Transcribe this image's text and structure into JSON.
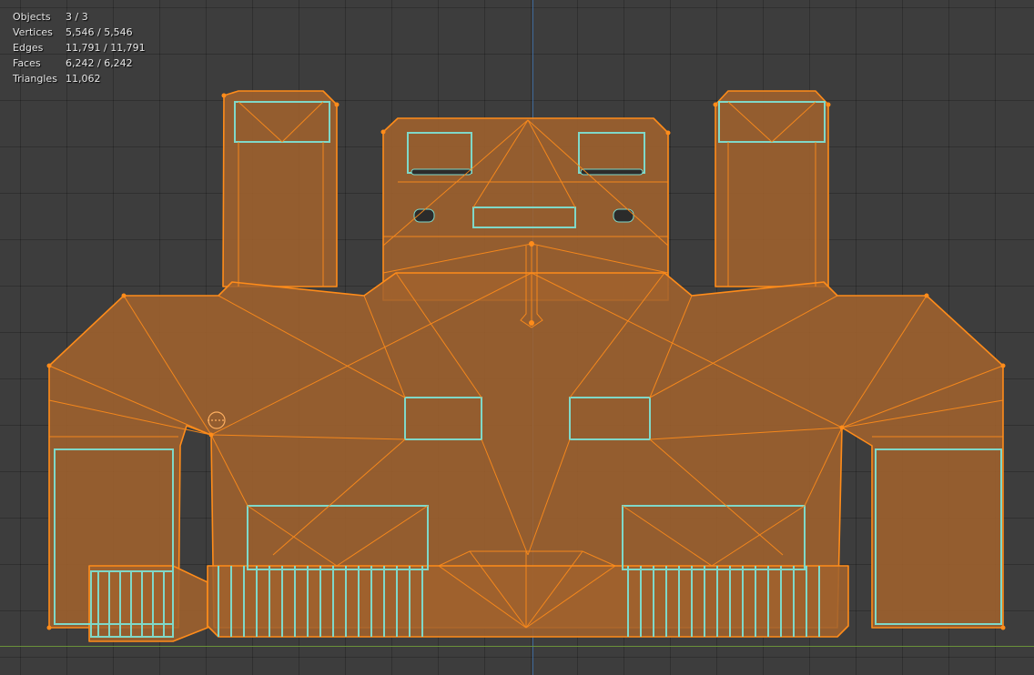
{
  "overlay": {
    "stats": [
      {
        "label": "Objects",
        "value": "3 / 3"
      },
      {
        "label": "Vertices",
        "value": "5,546 / 5,546"
      },
      {
        "label": "Edges",
        "value": "11,791 / 11,791"
      },
      {
        "label": "Faces",
        "value": "6,242 / 6,242"
      },
      {
        "label": "Triangles",
        "value": "11,062"
      }
    ]
  },
  "colors": {
    "background": "#3d3d3d",
    "grid": "#333333",
    "wire": "#ff8c1a",
    "face_fill": "#a0622e",
    "edge_highlight": "#7fd8c8",
    "axis_x": "#6e9a3a",
    "axis_z": "#3d6ea8"
  }
}
